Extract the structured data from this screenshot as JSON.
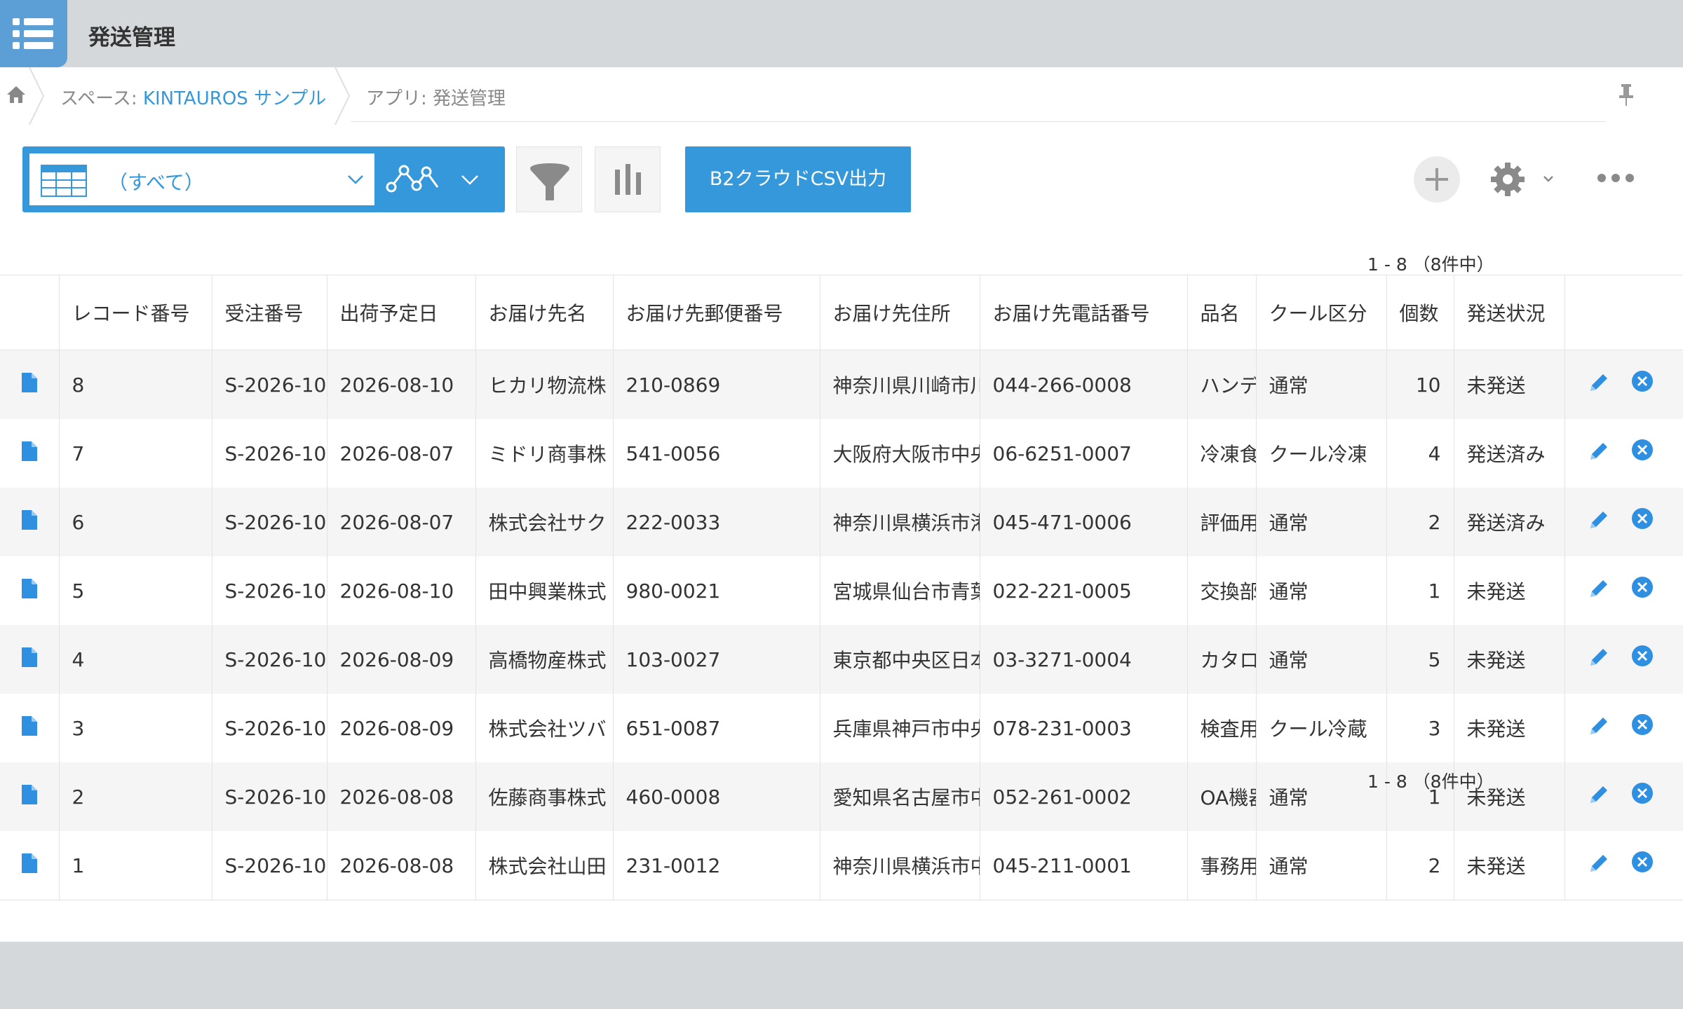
{
  "app": {
    "title": "発送管理"
  },
  "breadcrumb": {
    "space_prefix": "スペース: ",
    "space_name": "KINTAUROS サンプル",
    "app_label": "アプリ: 発送管理"
  },
  "toolbar": {
    "view_name": "（すべて）",
    "csv_button": "B2クラウドCSV出力"
  },
  "pagination": {
    "top": "1 - 8 （8件中）",
    "bottom": "1 - 8 （8件中）"
  },
  "table": {
    "columns": [
      "レコード番号",
      "受注番号",
      "出荷予定日",
      "お届け先名",
      "お届け先郵便番号",
      "お届け先住所",
      "お届け先電話番号",
      "品名",
      "クール区分",
      "個数",
      "発送状況"
    ],
    "rows": [
      [
        "8",
        "S-2026-10",
        "2026-08-10",
        "ヒカリ物流株",
        "210-0869",
        "神奈川県川崎市川",
        "044-266-0008",
        "ハンデ",
        "通常",
        "10",
        "未発送"
      ],
      [
        "7",
        "S-2026-10",
        "2026-08-07",
        "ミドリ商事株",
        "541-0056",
        "大阪府大阪市中央",
        "06-6251-0007",
        "冷凍食",
        "クール冷凍",
        "4",
        "発送済み"
      ],
      [
        "6",
        "S-2026-10",
        "2026-08-07",
        "株式会社サク",
        "222-0033",
        "神奈川県横浜市港",
        "045-471-0006",
        "評価用",
        "通常",
        "2",
        "発送済み"
      ],
      [
        "5",
        "S-2026-10",
        "2026-08-10",
        "田中興業株式",
        "980-0021",
        "宮城県仙台市青葉",
        "022-221-0005",
        "交換部",
        "通常",
        "1",
        "未発送"
      ],
      [
        "4",
        "S-2026-10",
        "2026-08-09",
        "高橋物産株式",
        "103-0027",
        "東京都中央区日本",
        "03-3271-0004",
        "カタロ",
        "通常",
        "5",
        "未発送"
      ],
      [
        "3",
        "S-2026-10",
        "2026-08-09",
        "株式会社ツバ",
        "651-0087",
        "兵庫県神戸市中央",
        "078-231-0003",
        "検査用",
        "クール冷蔵",
        "3",
        "未発送"
      ],
      [
        "2",
        "S-2026-10",
        "2026-08-08",
        "佐藤商事株式",
        "460-0008",
        "愛知県名古屋市中",
        "052-261-0002",
        "OA機器",
        "通常",
        "1",
        "未発送"
      ],
      [
        "1",
        "S-2026-10",
        "2026-08-08",
        "株式会社山田",
        "231-0012",
        "神奈川県横浜市中",
        "045-211-0001",
        "事務用",
        "通常",
        "2",
        "未発送"
      ]
    ]
  },
  "colors": {
    "accent": "#3498db",
    "header_bg": "#d5d8da",
    "row_alt": "#f5f5f5",
    "icon_blue": "#2f8fe0"
  },
  "icons": {
    "app": "list-icon",
    "home": "home-icon",
    "pin": "pin-icon",
    "view": "table-view-icon",
    "graph": "graph-icon",
    "filter": "funnel-icon",
    "chart": "bar-chart-icon",
    "add": "plus-icon",
    "settings": "gear-icon",
    "more": "ellipsis-icon",
    "record": "document-icon",
    "edit": "pencil-icon",
    "delete": "close-circle-icon"
  }
}
